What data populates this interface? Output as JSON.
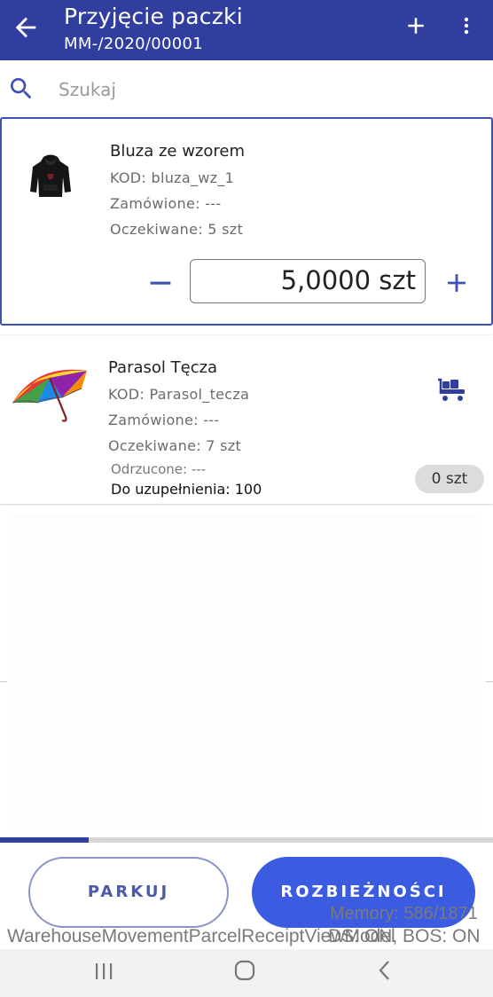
{
  "appbar": {
    "title": "Przyjęcie paczki",
    "subtitle": "MM-/2020/00001",
    "color": "#303f9f"
  },
  "search": {
    "placeholder": "Szukaj",
    "value": ""
  },
  "items": [
    {
      "name": "Bluza ze wzorem",
      "code": "KOD: bluza_wz_1",
      "ordered": "Zamówione: ---",
      "expected": "Oczekiwane: 5 szt",
      "quantity": "5,0000 szt",
      "image_icon": "hoodie-image"
    },
    {
      "name": "Parasol Tęcza",
      "code": "KOD: Parasol_tecza",
      "ordered": "Zamówione: ---",
      "expected": "Oczekiwane: 7 szt",
      "rejected": "Odrzucone: ---",
      "to_fill": "Do uzupełnienia: 100",
      "count_badge": "0 szt",
      "image_icon": "umbrella-image",
      "action_icon": "cart-icon"
    }
  ],
  "progress": {
    "fraction": 0.18
  },
  "buttons": {
    "park": "PARKUJ",
    "discrepancies": "ROZBIEŻNOŚCI"
  },
  "debug": {
    "memory": "Memory: 586/1871",
    "view": "WarehouseMovementParcelReceiptViewModel",
    "flags": "DS: ON, BOS: ON"
  },
  "accent": "#3b5be0"
}
